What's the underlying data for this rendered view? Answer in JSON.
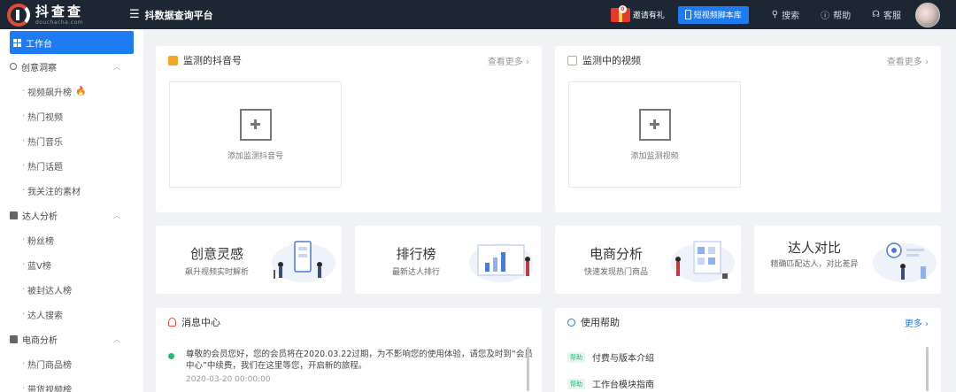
{
  "topbar": {
    "logo_title": "抖查查",
    "logo_sub": "douchacha.com",
    "platform_name": "抖数据查询平台",
    "invite_label": "邀请有礼",
    "invite_badge": "0",
    "script_button": "短视频脚本库",
    "search": "搜索",
    "help": "帮助",
    "service": "客服"
  },
  "sidebar": {
    "workbench": "工作台",
    "groups": [
      {
        "label": "创意洞察",
        "items": [
          "视频飙升榜",
          "热门视频",
          "热门音乐",
          "热门话题",
          "我关注的素材"
        ]
      },
      {
        "label": "达人分析",
        "items": [
          "粉丝榜",
          "蓝V榜",
          "被封达人榜",
          "达人搜索"
        ]
      },
      {
        "label": "电商分析",
        "items": [
          "热门商品榜",
          "带货视频榜"
        ]
      }
    ]
  },
  "monitor_accounts": {
    "title": "监测的抖音号",
    "more": "查看更多",
    "add_label": "添加监测抖音号"
  },
  "monitor_videos": {
    "title": "监测中的视频",
    "more": "查看更多",
    "add_label": "添加监测视频"
  },
  "features": [
    {
      "title": "创意灵感",
      "desc": "飙升视频实时解析"
    },
    {
      "title": "排行榜",
      "desc": "最新达人排行"
    },
    {
      "title": "电商分析",
      "desc": "快速发现热门商品"
    },
    {
      "title": "达人对比",
      "desc": "精确匹配达人，对比差异"
    }
  ],
  "messages": {
    "title": "消息中心",
    "items": [
      {
        "text": "尊敬的会员您好，您的会员将在2020.03.22过期，为不影响您的使用体验，请您及时到“会员中心”中续费，我们在这里等您，开启新的旅程。",
        "time": "2020-03-20 00:00:00"
      }
    ]
  },
  "help": {
    "title": "使用帮助",
    "more": "更多",
    "items": [
      {
        "tag": "帮助",
        "label": "付费与版本介绍"
      },
      {
        "tag": "帮助",
        "label": "工作台模块指南"
      }
    ]
  },
  "colors": {
    "primary": "#1e7cf2",
    "topbar": "#1d2733",
    "accent_red": "#e24a3b",
    "green": "#1dbf73"
  }
}
